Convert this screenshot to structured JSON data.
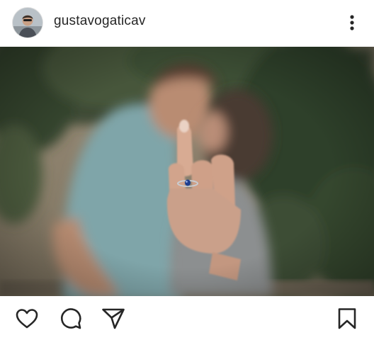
{
  "post": {
    "username": "gustavogaticav"
  },
  "icons": {
    "avatar": "profile-avatar",
    "more": "more-vertical-icon",
    "like": "heart-icon",
    "comment": "comment-bubble-icon",
    "share": "paper-plane-icon",
    "save": "bookmark-icon"
  },
  "colors": {
    "text": "#262626",
    "icon": "#262626",
    "background": "#ffffff"
  }
}
